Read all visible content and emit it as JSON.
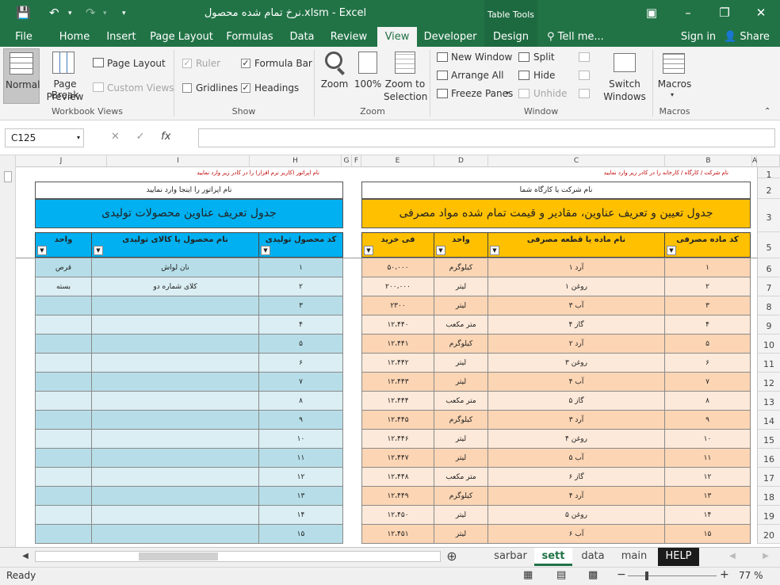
{
  "title": "نرخ تمام شده محصول.xlsm - Excel",
  "table_tools": "Table Tools",
  "tabs": [
    "File",
    "Home",
    "Insert",
    "Page Layout",
    "Formulas",
    "Data",
    "Review",
    "View",
    "Developer",
    "Design"
  ],
  "tell_me": "Tell me...",
  "sign_in": "Sign in",
  "share": "Share",
  "ribbon": {
    "normal": "Normal",
    "page_break_1": "Page Break",
    "page_break_2": "Preview",
    "page_layout": "Page Layout",
    "custom_views": "Custom Views",
    "workbook_views": "Workbook Views",
    "ruler": "Ruler",
    "formula_bar": "Formula Bar",
    "gridlines": "Gridlines",
    "headings": "Headings",
    "show": "Show",
    "zoom": "Zoom",
    "zoom100": "100%",
    "zoom_sel_1": "Zoom to",
    "zoom_sel_2": "Selection",
    "zoom_grp": "Zoom",
    "new_window": "New Window",
    "arrange_all": "Arrange All",
    "freeze_panes": "Freeze Panes",
    "split": "Split",
    "hide": "Hide",
    "unhide": "Unhide",
    "window_grp": "Window",
    "switch_1": "Switch",
    "switch_2": "Windows",
    "macros": "Macros",
    "macros_grp": "Macros"
  },
  "formula_bar": {
    "name_box": "C125",
    "fx": "fx",
    "formula": ""
  },
  "columns": [
    "J",
    "I",
    "H",
    "G",
    "F",
    "E",
    "D",
    "C",
    "B",
    "A"
  ],
  "rows": [
    "1",
    "2",
    "3",
    "5",
    "6",
    "7",
    "8",
    "9",
    "10",
    "11",
    "12",
    "13",
    "14",
    "15",
    "16",
    "17",
    "18",
    "19",
    "20"
  ],
  "left_table": {
    "note": "نام اپراتور (کاربر نرم افزار) را در کادر زیر وارد نمایید",
    "name_label": "نام اپراتور را اینجا وارد نمایید",
    "title": "جدول تعریف عناوین محصولات تولیدی",
    "headers": {
      "code": "کد محصول تولیدی",
      "name": "نام محصول یا کالای تولیدی",
      "unit": "واحد"
    },
    "rows": [
      {
        "code": "۱",
        "name": "نان لواش",
        "unit": "قرص"
      },
      {
        "code": "۲",
        "name": "کلای شماره دو",
        "unit": "بسته"
      },
      {
        "code": "۳",
        "name": "",
        "unit": ""
      },
      {
        "code": "۴",
        "name": "",
        "unit": ""
      },
      {
        "code": "۵",
        "name": "",
        "unit": ""
      },
      {
        "code": "۶",
        "name": "",
        "unit": ""
      },
      {
        "code": "۷",
        "name": "",
        "unit": ""
      },
      {
        "code": "۸",
        "name": "",
        "unit": ""
      },
      {
        "code": "۹",
        "name": "",
        "unit": ""
      },
      {
        "code": "۱۰",
        "name": "",
        "unit": ""
      },
      {
        "code": "۱۱",
        "name": "",
        "unit": ""
      },
      {
        "code": "۱۲",
        "name": "",
        "unit": ""
      },
      {
        "code": "۱۳",
        "name": "",
        "unit": ""
      },
      {
        "code": "۱۴",
        "name": "",
        "unit": ""
      },
      {
        "code": "۱۵",
        "name": "",
        "unit": ""
      }
    ]
  },
  "right_table": {
    "note": "نام شرکت / کارگاه / کارخانه را در کادر زیر وارد نمایید",
    "name_label": "نام شرکت یا کارگاه شما",
    "title": "جدول تعیین و تعریف عناوین، مقادیر و قیمت تمام شده مواد مصرفی",
    "headers": {
      "code": "کد ماده مصرفی",
      "name": "نام ماده یا قطعه مصرفی",
      "unit": "واحد",
      "price": "فی خرید"
    },
    "rows": [
      {
        "code": "۱",
        "name": "آرد ۱",
        "unit": "کیلوگرم",
        "price": "۵۰،۰۰۰"
      },
      {
        "code": "۲",
        "name": "روغن ۱",
        "unit": "لیتر",
        "price": "۲۰۰،۰۰۰"
      },
      {
        "code": "۳",
        "name": "آب ۳",
        "unit": "لیتر",
        "price": "۲۳۰۰"
      },
      {
        "code": "۴",
        "name": "گاز ۴",
        "unit": "متر مکعب",
        "price": "۱۲،۴۴۰"
      },
      {
        "code": "۵",
        "name": "آرد ۲",
        "unit": "کیلوگرم",
        "price": "۱۲،۴۴۱"
      },
      {
        "code": "۶",
        "name": "روغن ۳",
        "unit": "لیتر",
        "price": "۱۲،۴۴۲"
      },
      {
        "code": "۷",
        "name": "آب ۴",
        "unit": "لیتر",
        "price": "۱۲،۴۴۳"
      },
      {
        "code": "۸",
        "name": "گاز ۵",
        "unit": "متر مکعب",
        "price": "۱۲،۴۴۴"
      },
      {
        "code": "۹",
        "name": "آرد ۳",
        "unit": "کیلوگرم",
        "price": "۱۲،۴۴۵"
      },
      {
        "code": "۱۰",
        "name": "روغن ۴",
        "unit": "لیتر",
        "price": "۱۲،۴۴۶"
      },
      {
        "code": "۱۱",
        "name": "آب ۵",
        "unit": "لیتر",
        "price": "۱۲،۴۴۷"
      },
      {
        "code": "۱۲",
        "name": "گاز ۶",
        "unit": "متر مکعب",
        "price": "۱۲،۴۴۸"
      },
      {
        "code": "۱۳",
        "name": "آرد ۴",
        "unit": "کیلوگرم",
        "price": "۱۲،۴۴۹"
      },
      {
        "code": "۱۴",
        "name": "روغن ۵",
        "unit": "لیتر",
        "price": "۱۲،۴۵۰"
      },
      {
        "code": "۱۵",
        "name": "آب ۶",
        "unit": "لیتر",
        "price": "۱۲،۴۵۱"
      }
    ]
  },
  "sheet_tabs": [
    "sarbar",
    "sett",
    "data",
    "main",
    "HELP"
  ],
  "status": {
    "ready": "Ready",
    "zoom": "77 %",
    "minus": "−",
    "plus": "+"
  },
  "colors": {
    "excel_green": "#217346",
    "orange": "#ffc000",
    "blue": "#00b0f0"
  }
}
